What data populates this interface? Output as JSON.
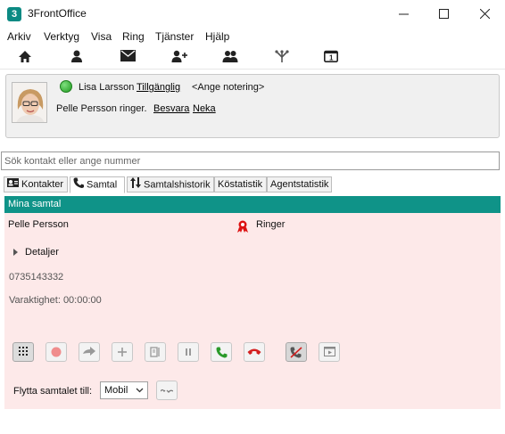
{
  "window": {
    "title": "3FrontOffice",
    "app_icon": "3frontoffice-logo",
    "accent_color": "#0f9388"
  },
  "menu": [
    "Arkiv",
    "Verktyg",
    "Visa",
    "Ring",
    "Tjänster",
    "Hjälp"
  ],
  "toolbar": [
    "home-icon",
    "person-icon",
    "mail-icon",
    "add-person-icon",
    "group-icon",
    "network-icon",
    "calendar-icon"
  ],
  "user": {
    "name": "Lisa Larsson",
    "status": "Tillgänglig",
    "status_color": "#1f9a1f",
    "note": "<Ange notering>",
    "incoming_text": "Pelle Persson ringer.",
    "answer": "Besvara",
    "decline": "Neka"
  },
  "search": {
    "placeholder": "Sök kontakt eller ange nummer"
  },
  "tabs": [
    {
      "label": "Kontakter",
      "icon": "contact-card-icon"
    },
    {
      "label": "Samtal",
      "icon": "phone-icon",
      "active": true
    },
    {
      "label": "Samtalshistorik",
      "icon": "history-arrows-icon"
    },
    {
      "label": "Köstatistik"
    },
    {
      "label": "Agentstatistik"
    }
  ],
  "calls": {
    "header": "Mina samtal",
    "caller": "Pelle Persson",
    "state": "Ringer",
    "details": "Detaljer",
    "number": "0735143332",
    "duration": "Varaktighet: 00:00:00",
    "controls": [
      "keypad-icon",
      "record-icon",
      "transfer-icon",
      "add-icon",
      "consult-icon",
      "hold-icon",
      "answer-icon",
      "hangup-icon",
      "mute-icon",
      "window-icon"
    ],
    "move_label": "Flytta samtalet till:",
    "move_target": "Mobil",
    "move_button": "move-call-icon",
    "background_color": "#fde9e9"
  }
}
